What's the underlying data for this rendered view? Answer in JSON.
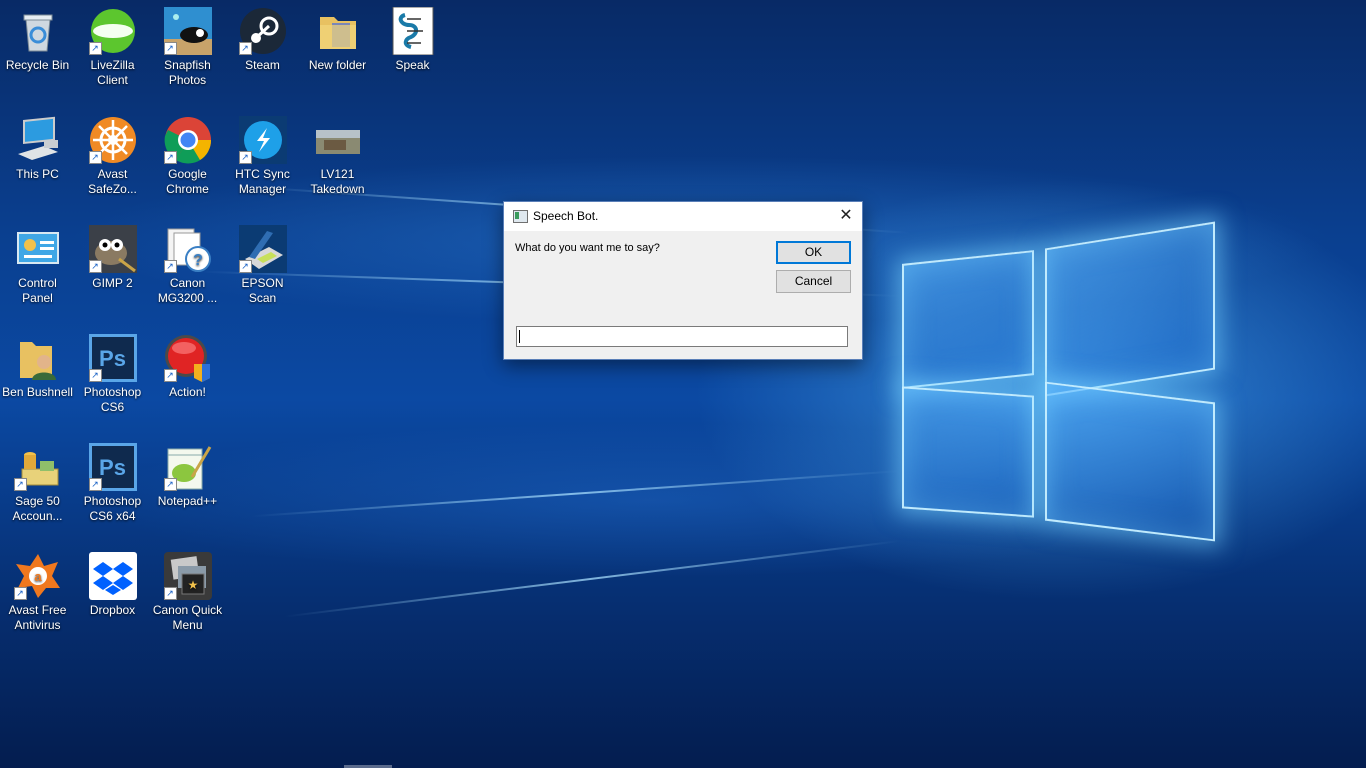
{
  "desktop": {
    "icons": [
      {
        "label": "Recycle Bin",
        "icon": "recycle-bin-icon",
        "shortcut": false
      },
      {
        "label": "LiveZilla Client",
        "icon": "livezilla-icon",
        "shortcut": true
      },
      {
        "label": "Snapfish Photos",
        "icon": "snapfish-icon",
        "shortcut": true
      },
      {
        "label": "Steam",
        "icon": "steam-icon",
        "shortcut": true
      },
      {
        "label": "New folder",
        "icon": "folder-icon",
        "shortcut": false
      },
      {
        "label": "Speak",
        "icon": "script-file-icon",
        "shortcut": false
      },
      {
        "label": "This PC",
        "icon": "computer-icon",
        "shortcut": false
      },
      {
        "label": "Avast SafeZo...",
        "icon": "avast-safezone-icon",
        "shortcut": true
      },
      {
        "label": "Google Chrome",
        "icon": "chrome-icon",
        "shortcut": true
      },
      {
        "label": "HTC Sync Manager",
        "icon": "htc-sync-icon",
        "shortcut": true
      },
      {
        "label": "LV121 Takedown",
        "icon": "image-file-icon",
        "shortcut": false
      },
      {
        "label": "Control Panel",
        "icon": "control-panel-icon",
        "shortcut": false
      },
      {
        "label": "GIMP 2",
        "icon": "gimp-icon",
        "shortcut": true
      },
      {
        "label": "Canon MG3200 ...",
        "icon": "canon-help-icon",
        "shortcut": true
      },
      {
        "label": "EPSON Scan",
        "icon": "scanner-icon",
        "shortcut": true
      },
      {
        "label": "Ben Bushnell",
        "icon": "user-folder-icon",
        "shortcut": false
      },
      {
        "label": "Photoshop CS6",
        "icon": "photoshop-icon",
        "shortcut": true
      },
      {
        "label": "Action!",
        "icon": "action-recorder-icon",
        "shortcut": true
      },
      {
        "label": "Sage 50 Accoun...",
        "icon": "sage-icon",
        "shortcut": true
      },
      {
        "label": "Photoshop CS6 x64",
        "icon": "photoshop-icon",
        "shortcut": true
      },
      {
        "label": "Notepad++",
        "icon": "notepad-plus-icon",
        "shortcut": true
      },
      {
        "label": "Avast Free Antivirus",
        "icon": "avast-icon",
        "shortcut": true
      },
      {
        "label": "Dropbox",
        "icon": "dropbox-icon",
        "shortcut": false
      },
      {
        "label": "Canon Quick Menu",
        "icon": "canon-quick-menu-icon",
        "shortcut": true
      }
    ],
    "shortcut_glyph": "↗"
  },
  "dialog": {
    "title": "Speech Bot.",
    "prompt": "What do you want me to say?",
    "ok_label": "OK",
    "cancel_label": "Cancel",
    "input_value": "",
    "close_glyph": "✕"
  },
  "colors": {
    "desktop_blue": "#0b49a3",
    "accent": "#0078d7"
  }
}
